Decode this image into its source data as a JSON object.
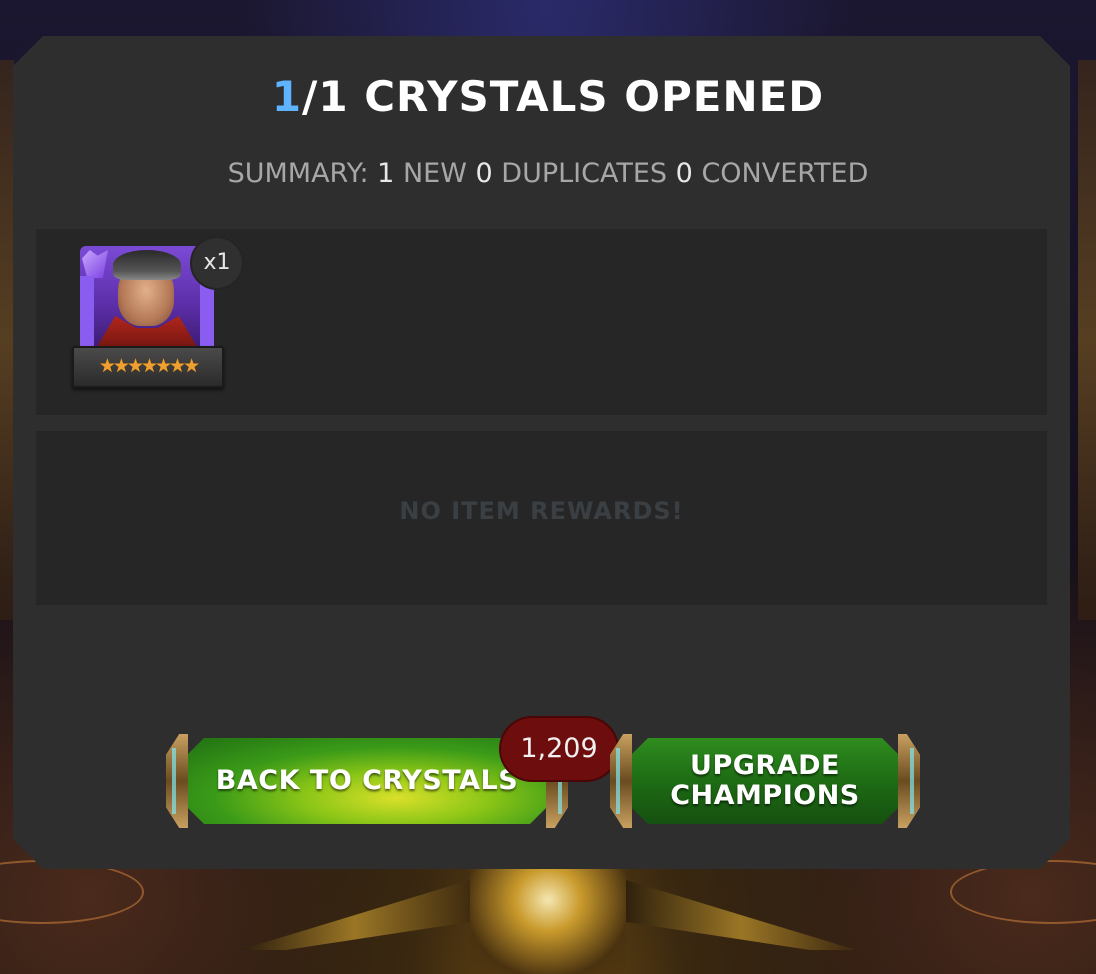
{
  "header": {
    "title_current": "1",
    "title_rest": "/1 CRYSTALS OPENED"
  },
  "summary": {
    "label": "SUMMARY:",
    "new_count": "1",
    "new_label": "NEW",
    "duplicates_count": "0",
    "duplicates_label": "DUPLICATES",
    "converted_count": "0",
    "converted_label": "CONVERTED"
  },
  "champions": [
    {
      "icon": "champion-portrait-icon",
      "quantity": "x1",
      "stars": "★★★★★★★",
      "star_count": 7
    }
  ],
  "item_rewards": {
    "empty_text": "NO ITEM REWARDS!"
  },
  "buttons": {
    "back_label": "BACK TO CRYSTALS",
    "back_badge": "1,209",
    "upgrade_label": "UPGRADE\nCHAMPIONS"
  },
  "colors": {
    "accent_blue": "#5fb4ff",
    "panel_bg": "#2e2e2e",
    "button_green": "#1e6c14",
    "badge_red": "#6e0d0d",
    "star_orange": "#f0a030"
  }
}
